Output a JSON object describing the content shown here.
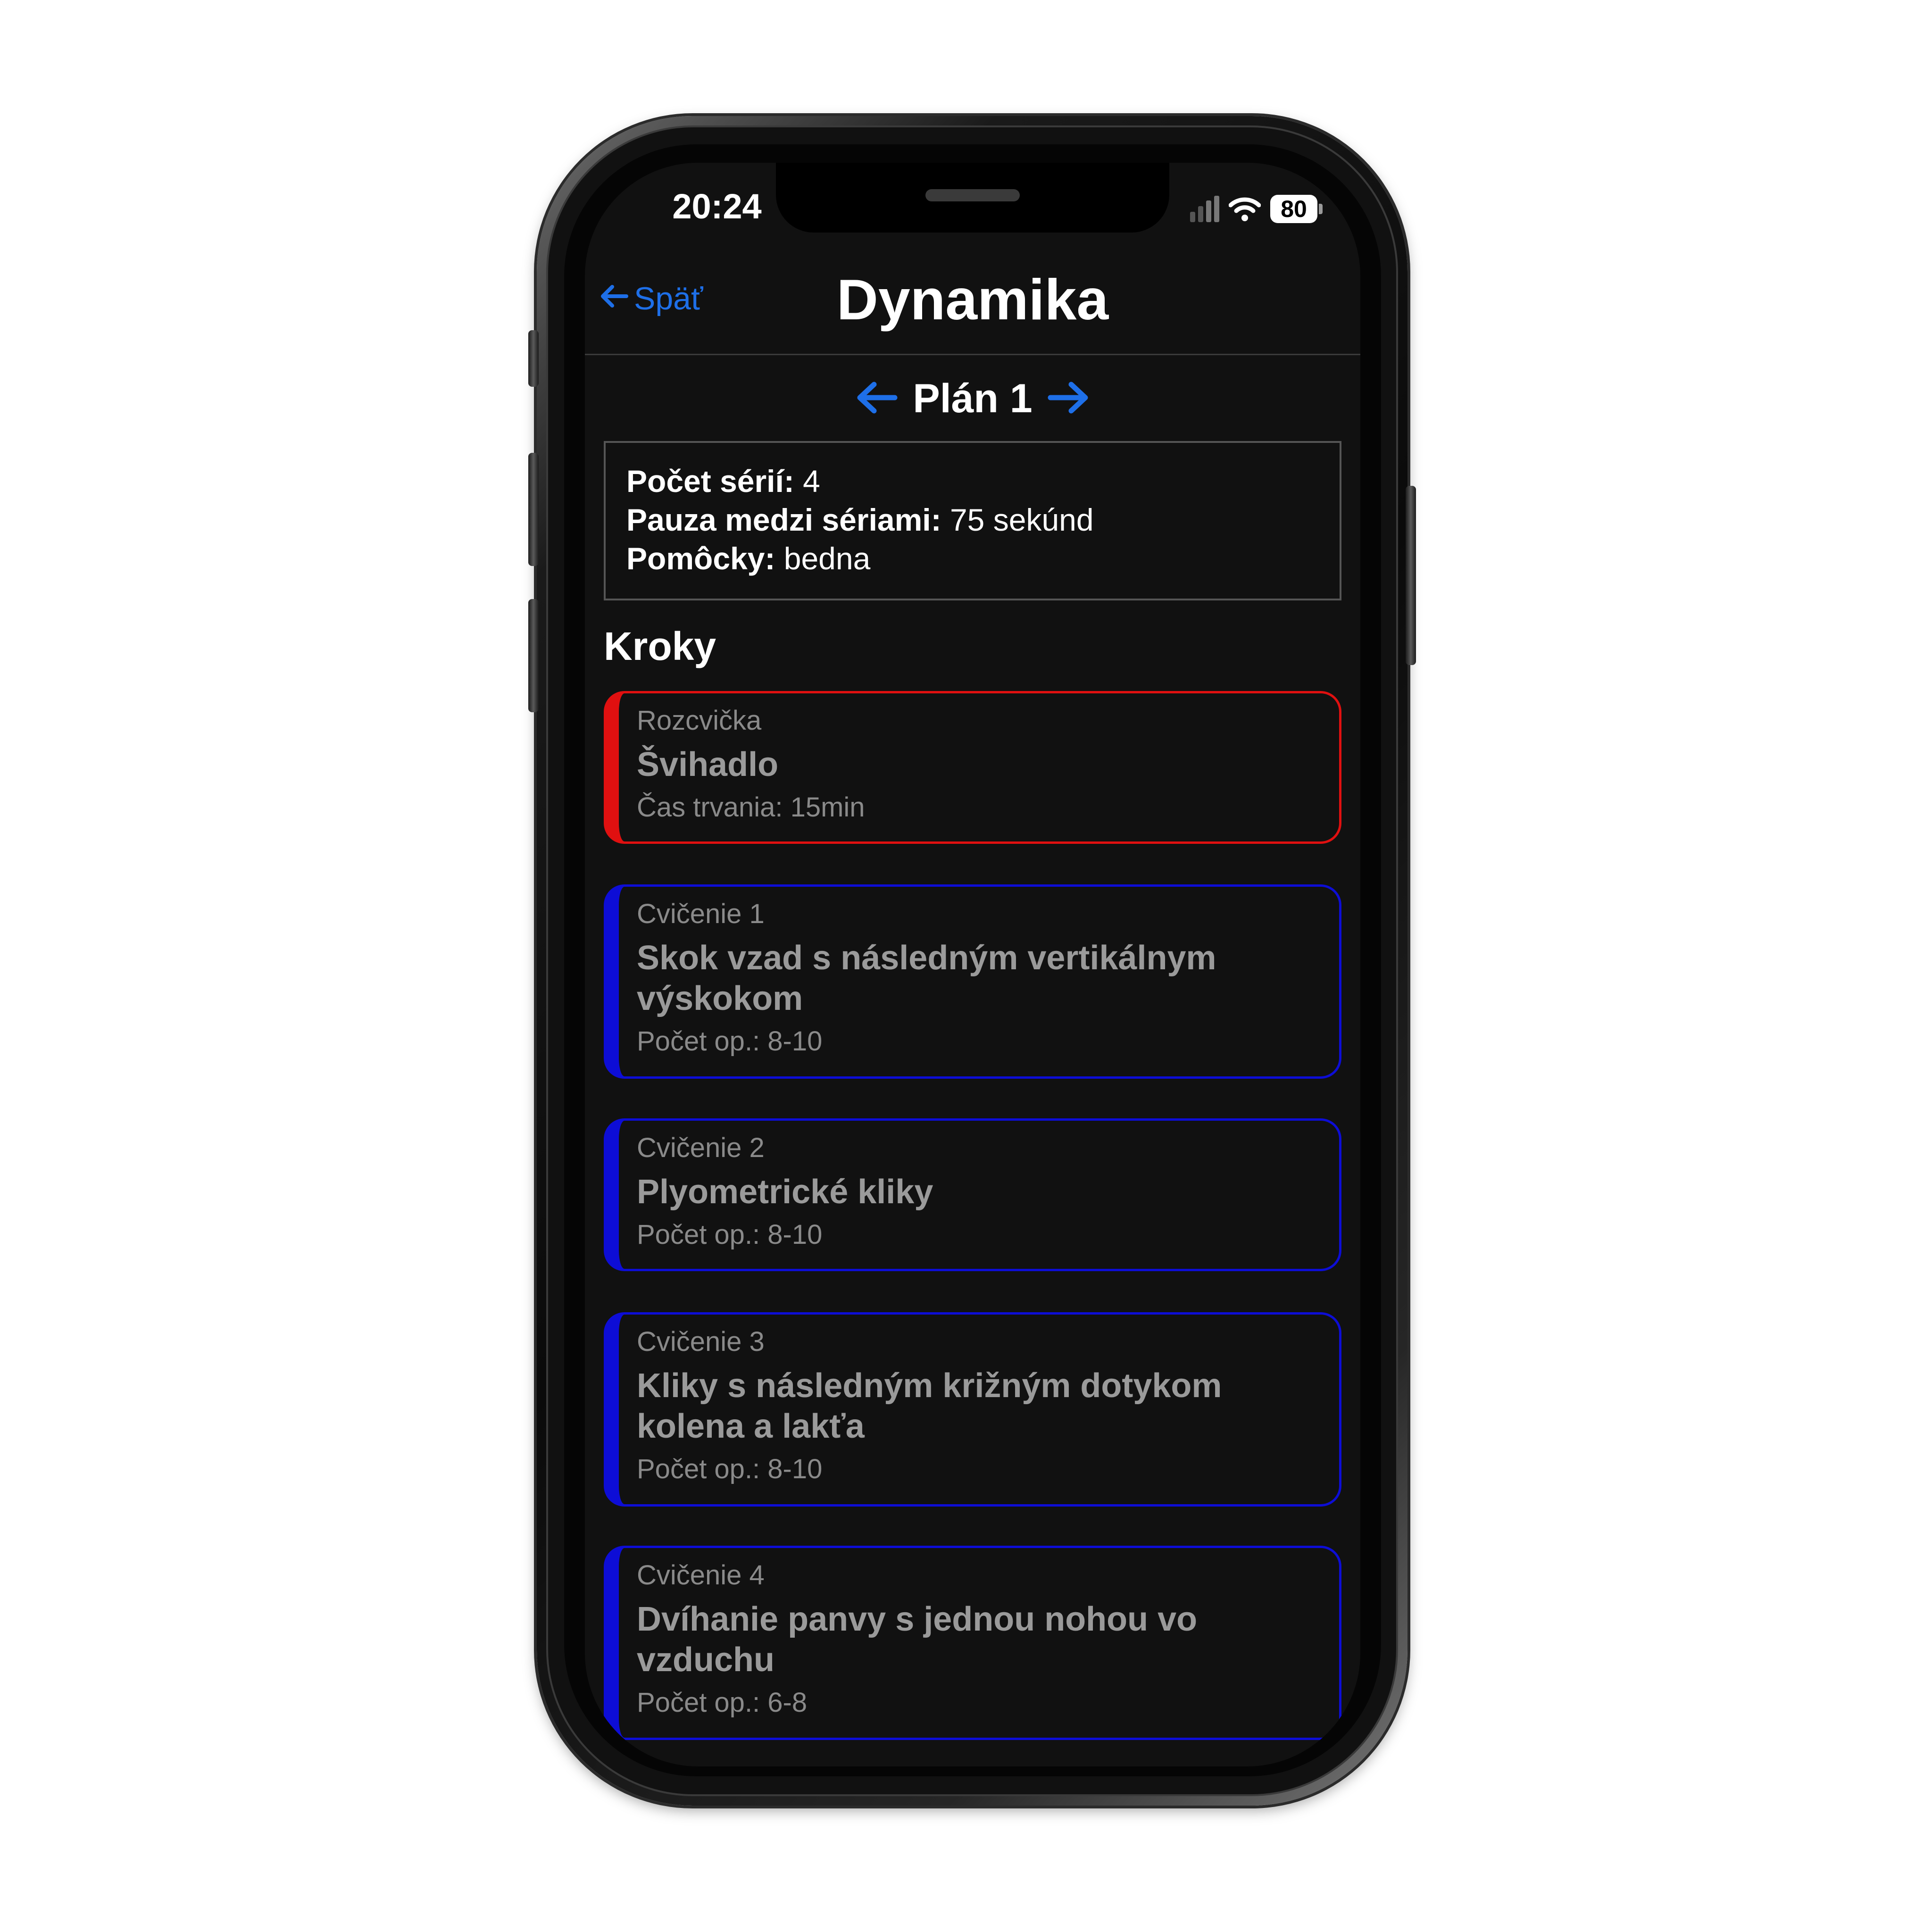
{
  "status_bar": {
    "time": "20:24",
    "battery": "80"
  },
  "nav": {
    "back_label": "Späť",
    "title": "Dynamika"
  },
  "plan": {
    "label": "Plán 1"
  },
  "info": {
    "series_label": "Počet sérií:",
    "series_value": " 4",
    "pause_label": "Pauza medzi sériami:",
    "pause_value": " 75 sekúnd",
    "tools_label": "Pomôcky:",
    "tools_value": " bedna"
  },
  "steps_title": "Kroky",
  "colors": {
    "accent": "#1e6fe8",
    "warmup_border": "#e01010",
    "exercise_border": "#0d0dd6",
    "background": "#111111"
  },
  "icons": {
    "back": "arrow-left-icon",
    "prev_plan": "arrow-left-icon",
    "next_plan": "arrow-right-icon",
    "wifi": "wifi-icon",
    "signal": "signal-icon",
    "battery": "battery-icon"
  },
  "steps": [
    {
      "category": "Rozcvička",
      "name": "Švihadlo",
      "meta": "Čas trvania: 15min"
    },
    {
      "category": "Cvičenie 1",
      "name": "Skok vzad s následným vertikálnym výskokom",
      "meta": "Počet op.: 8-10"
    },
    {
      "category": "Cvičenie 2",
      "name": "Plyometrické kliky",
      "meta": "Počet op.: 8-10"
    },
    {
      "category": "Cvičenie 3",
      "name": "Kliky s následným križným dotykom kolena a lakťa",
      "meta": "Počet op.: 8-10"
    },
    {
      "category": "Cvičenie 4",
      "name": "Dvíhanie panvy s jednou nohou vo vzduchu",
      "meta": "Počet op.: 6-8"
    }
  ]
}
